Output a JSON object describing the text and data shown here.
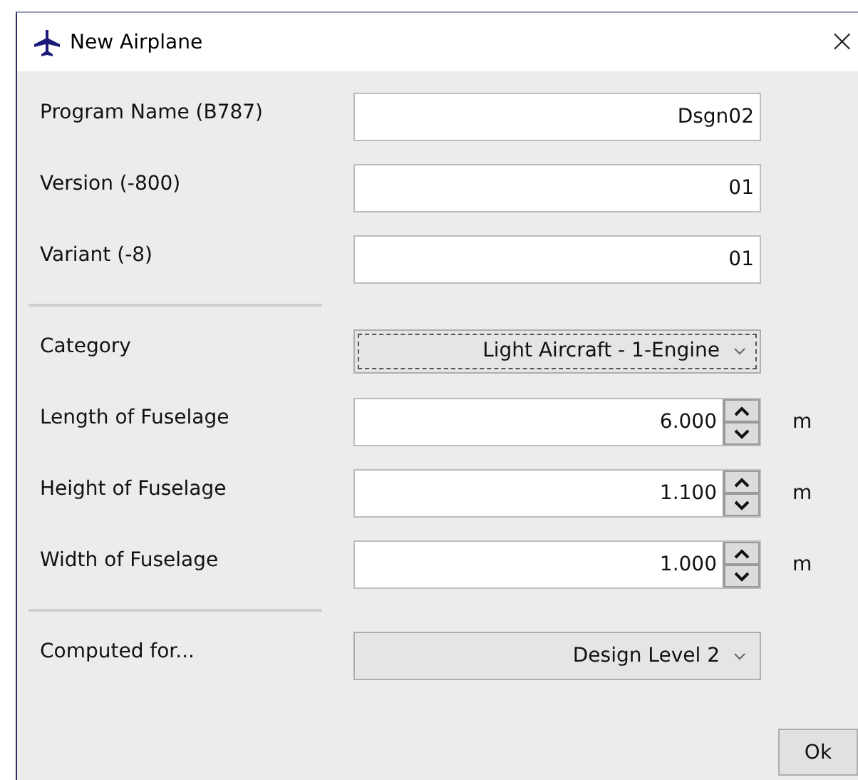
{
  "window": {
    "title": "New Airplane",
    "close": "×"
  },
  "sections": [
    {
      "rows": [
        {
          "kind": "text",
          "label": "Program Name (B787)",
          "value": "Dsgn02"
        },
        {
          "kind": "text",
          "label": "Version (-800)",
          "value": "01"
        },
        {
          "kind": "text",
          "label": "Variant (-8)",
          "value": "01"
        }
      ]
    },
    {
      "rows": [
        {
          "kind": "combo",
          "label": "Category",
          "value": "Light Aircraft - 1-Engine",
          "focused": true
        },
        {
          "kind": "spinner",
          "label": "Length of Fuselage",
          "value": "6.000",
          "unit": "m"
        },
        {
          "kind": "spinner",
          "label": "Height of Fuselage",
          "value": "1.100",
          "unit": "m"
        },
        {
          "kind": "spinner",
          "label": "Width of Fuselage",
          "value": "1.000",
          "unit": "m"
        }
      ]
    },
    {
      "rows": [
        {
          "kind": "combo",
          "label": "Computed for...",
          "value": "Design Level 2",
          "focused": false
        }
      ]
    }
  ],
  "buttons": [
    {
      "label": "Ok"
    }
  ]
}
